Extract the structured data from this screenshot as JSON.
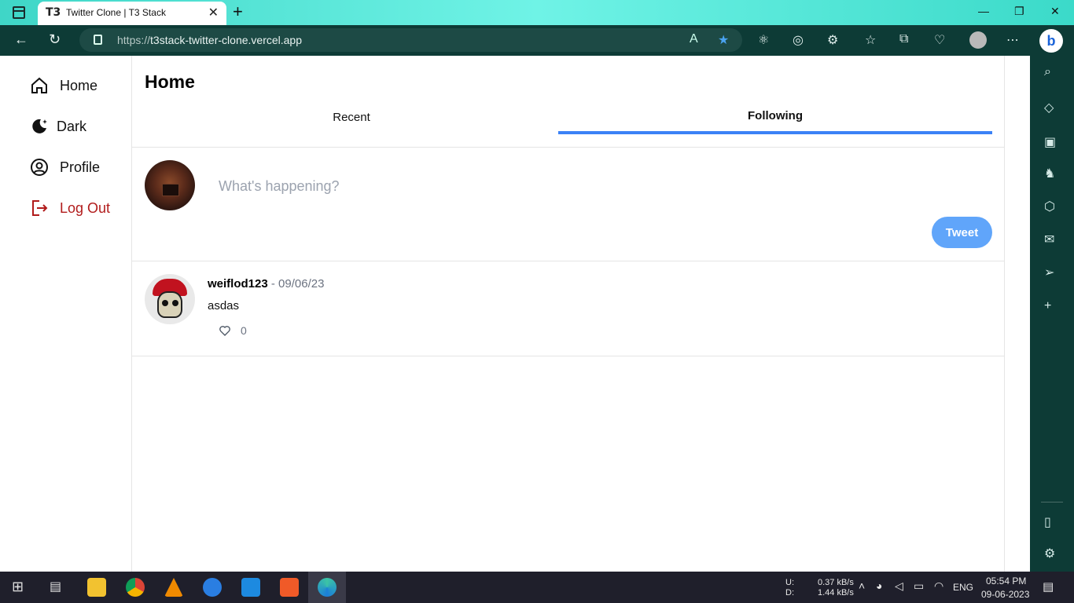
{
  "browser": {
    "tab_title": "Twitter Clone | T3 Stack",
    "tab_favicon": "T3",
    "url_prefix": "https://",
    "url_host": "t3stack-twitter-clone.vercel.app"
  },
  "sidebar": {
    "items": [
      {
        "label": "Home",
        "icon": "home-icon"
      },
      {
        "label": "Dark",
        "icon": "moon-icon"
      },
      {
        "label": "Profile",
        "icon": "user-circle-icon"
      },
      {
        "label": "Log Out",
        "icon": "logout-icon"
      }
    ]
  },
  "main": {
    "title": "Home",
    "tabs": [
      {
        "label": "Recent",
        "active": false
      },
      {
        "label": "Following",
        "active": true
      }
    ],
    "compose": {
      "placeholder": "What's happening?",
      "button_label": "Tweet"
    },
    "tweets": [
      {
        "user": "weiflod123",
        "separator": " - ",
        "date": "09/06/23",
        "text": "asdas",
        "likes": "0"
      }
    ]
  },
  "taskbar": {
    "net_up_label": "U:",
    "net_down_label": "D:",
    "net_up": "0.37 kB/s",
    "net_down": "1.44 kB/s",
    "lang": "ENG",
    "time": "05:54 PM",
    "date": "09-06-2023"
  },
  "colors": {
    "accent": "#3b82f6",
    "tweet_button": "#60a5fa",
    "logout": "#b11b1b",
    "browser_chrome": "#0d3b36"
  }
}
